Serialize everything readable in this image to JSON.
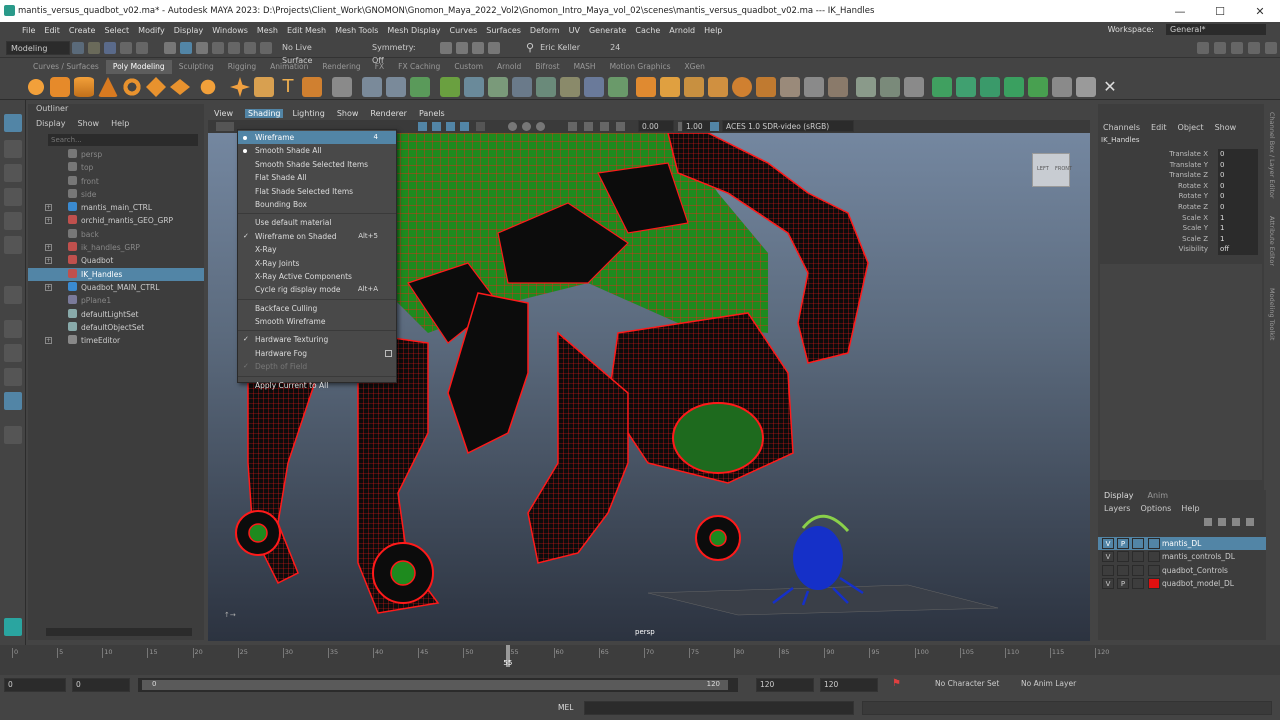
{
  "window": {
    "title": "mantis_versus_quadbot_v02.ma* - Autodesk MAYA 2023: D:\\Projects\\Client_Work\\GNOMON\\Gnomon_Maya_2022_Vol2\\Gnomon_Intro_Maya_vol_02\\scenes\\mantis_versus_quadbot_v02.ma   ---   IK_Handles",
    "minimize": "—",
    "maximize": "☐",
    "close": "✕"
  },
  "menubar": [
    "File",
    "Edit",
    "Create",
    "Select",
    "Modify",
    "Display",
    "Windows",
    "Mesh",
    "Edit Mesh",
    "Mesh Tools",
    "Mesh Display",
    "Curves",
    "Surfaces",
    "Deform",
    "UV",
    "Generate",
    "Cache",
    "Arnold",
    "Help"
  ],
  "workspace": {
    "label": "Workspace:",
    "value": "General*"
  },
  "statusline": {
    "mode": "Modeling",
    "live_surface": "No Live Surface",
    "symmetry": "Symmetry: Off",
    "user": "Eric Keller",
    "frame": "24"
  },
  "shelf_tabs": [
    "Curves / Surfaces",
    "Poly Modeling",
    "Sculpting",
    "Rigging",
    "Animation",
    "Rendering",
    "FX",
    "FX Caching",
    "Custom",
    "Arnold",
    "Bifrost",
    "MASH",
    "Motion Graphics",
    "XGen"
  ],
  "shelf_active": "Poly Modeling",
  "outliner": {
    "title": "Outliner",
    "menu": [
      "Display",
      "Show",
      "Help"
    ],
    "search_placeholder": "Search...",
    "rows": [
      {
        "label": "persp",
        "dim": true,
        "icon": "camera-icon",
        "expand": ""
      },
      {
        "label": "top",
        "dim": true,
        "icon": "camera-icon",
        "expand": ""
      },
      {
        "label": "front",
        "dim": true,
        "icon": "camera-icon",
        "expand": ""
      },
      {
        "label": "side",
        "dim": true,
        "icon": "camera-icon",
        "expand": ""
      },
      {
        "label": "mantis_main_CTRL",
        "dim": false,
        "icon": "curve-icon",
        "expand": "+"
      },
      {
        "label": "orchid_mantis_GEO_GRP",
        "dim": false,
        "icon": "group-icon",
        "expand": "+"
      },
      {
        "label": "back",
        "dim": true,
        "icon": "camera-icon",
        "expand": ""
      },
      {
        "label": "ik_handles_GRP",
        "dim": true,
        "icon": "group-icon",
        "expand": "+"
      },
      {
        "label": "Quadbot",
        "dim": false,
        "icon": "group-icon",
        "expand": "+"
      },
      {
        "label": "IK_Handles",
        "dim": false,
        "icon": "group-icon",
        "expand": "",
        "selected": true
      },
      {
        "label": "Quadbot_MAIN_CTRL",
        "dim": false,
        "icon": "curve-icon",
        "expand": "+"
      },
      {
        "label": "pPlane1",
        "dim": true,
        "icon": "mesh-icon",
        "expand": ""
      },
      {
        "label": "defaultLightSet",
        "dim": false,
        "icon": "set-icon",
        "expand": ""
      },
      {
        "label": "defaultObjectSet",
        "dim": false,
        "icon": "set-icon",
        "expand": ""
      },
      {
        "label": "timeEditor",
        "dim": false,
        "icon": "clock-icon",
        "expand": "+"
      }
    ]
  },
  "viewport": {
    "menu": [
      "View",
      "Shading",
      "Lighting",
      "Show",
      "Renderer",
      "Panels"
    ],
    "active_menu": "Shading",
    "exposure": "0.00",
    "gamma": "1.00",
    "colorspace": "ACES 1.0 SDR-video (sRGB)",
    "camera_label": "persp",
    "viewcube_left": "LEFT",
    "viewcube_front": "FRONT"
  },
  "shading_menu": [
    {
      "label": "Wireframe",
      "shortcut": "4",
      "highlight": true,
      "mark": "radio"
    },
    {
      "label": "Smooth Shade All",
      "shortcut": "",
      "mark": "radio"
    },
    {
      "label": "Smooth Shade Selected Items",
      "shortcut": ""
    },
    {
      "label": "Flat Shade All",
      "shortcut": ""
    },
    {
      "label": "Flat Shade Selected Items",
      "shortcut": ""
    },
    {
      "label": "Bounding Box",
      "shortcut": "",
      "sep_after": true
    },
    {
      "label": "Use default material",
      "shortcut": ""
    },
    {
      "label": "Wireframe on Shaded",
      "shortcut": "Alt+5",
      "mark": "check"
    },
    {
      "label": "X-Ray",
      "shortcut": ""
    },
    {
      "label": "X-Ray Joints",
      "shortcut": ""
    },
    {
      "label": "X-Ray Active Components",
      "shortcut": ""
    },
    {
      "label": "Cycle rig display mode",
      "shortcut": "Alt+A",
      "sep_after": true
    },
    {
      "label": "Backface Culling",
      "shortcut": ""
    },
    {
      "label": "Smooth Wireframe",
      "shortcut": "",
      "sep_after": true
    },
    {
      "label": "Hardware Texturing",
      "shortcut": "",
      "mark": "check"
    },
    {
      "label": "Hardware Fog",
      "shortcut": "",
      "option_box": true
    },
    {
      "label": "Depth of Field",
      "shortcut": "",
      "mark": "check",
      "disabled": true,
      "sep_after": true
    },
    {
      "label": "Apply Current to All",
      "shortcut": ""
    }
  ],
  "channelbox": {
    "menu": [
      "Channels",
      "Edit",
      "Object",
      "Show"
    ],
    "object": "IK_Handles",
    "attrs": [
      {
        "name": "Translate X",
        "value": "0"
      },
      {
        "name": "Translate Y",
        "value": "0"
      },
      {
        "name": "Translate Z",
        "value": "0"
      },
      {
        "name": "Rotate X",
        "value": "0"
      },
      {
        "name": "Rotate Y",
        "value": "0"
      },
      {
        "name": "Rotate Z",
        "value": "0"
      },
      {
        "name": "Scale X",
        "value": "1"
      },
      {
        "name": "Scale Y",
        "value": "1"
      },
      {
        "name": "Scale Z",
        "value": "1"
      },
      {
        "name": "Visibility",
        "value": "off"
      }
    ],
    "side_tabs": [
      "Channel Box / Layer Editor",
      "Attribute Editor",
      "Modeling Toolkit"
    ]
  },
  "layers": {
    "tabs": [
      "Display",
      "Anim"
    ],
    "menu": [
      "Layers",
      "Options",
      "Help"
    ],
    "rows": [
      {
        "v": "V",
        "p": "P",
        "name": "mantis_DL",
        "color": "",
        "selected": true
      },
      {
        "v": "V",
        "p": "",
        "name": "mantis_controls_DL",
        "color": ""
      },
      {
        "v": "",
        "p": "",
        "name": "quadbot_Controls",
        "color": ""
      },
      {
        "v": "V",
        "p": "P",
        "name": "quadbot_model_DL",
        "color": "#e01010"
      }
    ]
  },
  "timeline": {
    "ticks": [
      "0",
      "5",
      "10",
      "15",
      "20",
      "25",
      "30",
      "35",
      "40",
      "45",
      "50",
      "55",
      "60",
      "65",
      "70",
      "75",
      "80",
      "85",
      "90",
      "95",
      "100",
      "105",
      "110",
      "115",
      "120"
    ],
    "current": "55"
  },
  "range": {
    "start": "0",
    "start2": "0",
    "slider_start": "0",
    "slider_end": "120",
    "end": "120",
    "end2": "120",
    "char_set": "No Character Set",
    "anim_layer": "No Anim Layer"
  },
  "cmdline": {
    "lang": "MEL"
  }
}
